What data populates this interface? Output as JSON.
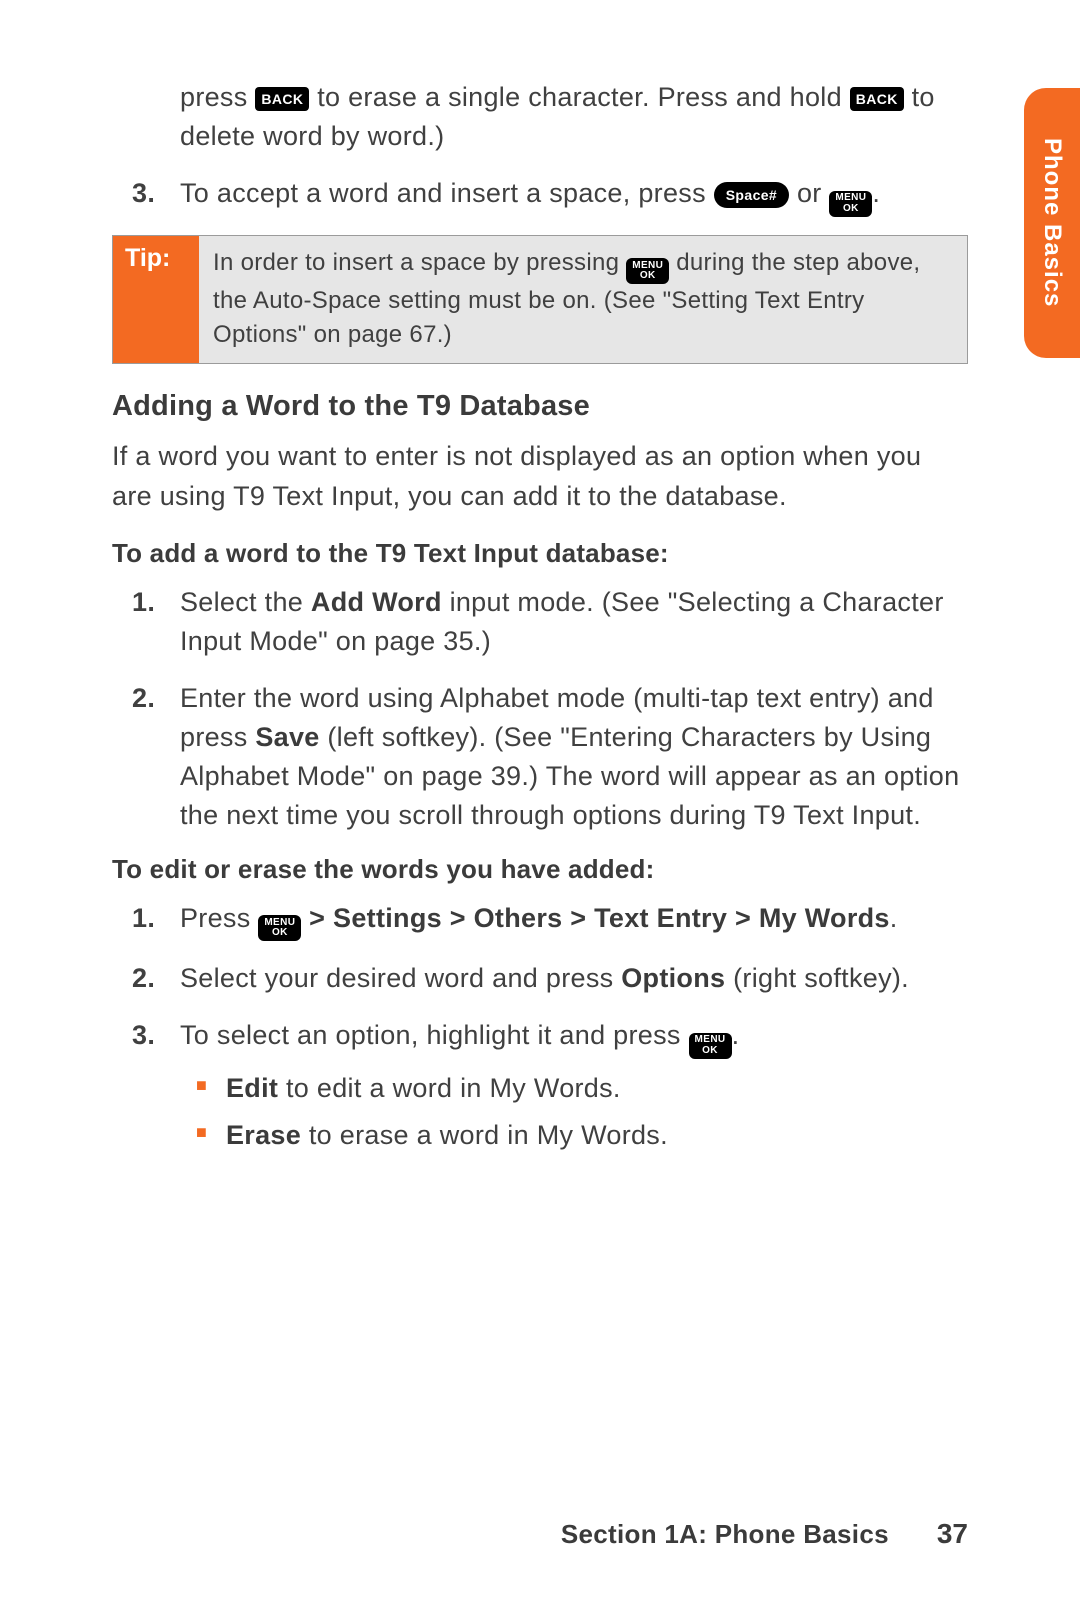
{
  "sideTab": "Phone Basics",
  "intro": {
    "line1_a": "press ",
    "line1_b": " to erase a single character. Press and hold ",
    "line1_c": " to delete word by word.)"
  },
  "step3": {
    "num": "3.",
    "a": "To accept a word and insert a space, press ",
    "b": " or ",
    "c": "."
  },
  "key_back": "BACK",
  "key_menu": "MENU",
  "key_ok": "OK",
  "key_space": "Space#",
  "tip": {
    "label": "Tip:",
    "a": "In order to insert a space by pressing ",
    "b": " during the step above, the Auto-Space setting must be on. (See \"Setting Text Entry Options\" on page 67.)"
  },
  "heading": "Adding a Word to the T9 Database",
  "introPara": "If a word you want to enter is not displayed as an option when you are using T9 Text Input, you can add it to the database.",
  "sub1": "To add a word to the T9 Text Input database:",
  "s1_1": {
    "num": "1.",
    "a": "Select the ",
    "bold": "Add Word",
    "b": " input mode. (See \"Selecting a Character Input Mode\" on page 35.)"
  },
  "s1_2": {
    "num": "2.",
    "a": "Enter the word using Alphabet mode (multi-tap text entry) and press ",
    "bold": "Save",
    "b": " (left softkey). (See \"Entering Characters by Using Alphabet Mode\" on page 39.) The word will appear as an option the next time you scroll through options during T9 Text Input."
  },
  "sub2": "To edit or erase the words you have added:",
  "s2_1": {
    "num": "1.",
    "a": "Press ",
    "bold": " > Settings > Others > Text Entry > My Words",
    "b": "."
  },
  "s2_2": {
    "num": "2.",
    "a": "Select your desired word and press ",
    "bold": "Options",
    "b": " (right softkey)."
  },
  "s2_3": {
    "num": "3.",
    "a": "To select an option, highlight it and press ",
    "b": "."
  },
  "bullets": {
    "edit_bold": "Edit",
    "edit_txt": " to edit a word in My Words.",
    "erase_bold": "Erase",
    "erase_txt": " to erase a word in My Words."
  },
  "footer": {
    "section": "Section 1A: Phone Basics",
    "page": "37"
  }
}
